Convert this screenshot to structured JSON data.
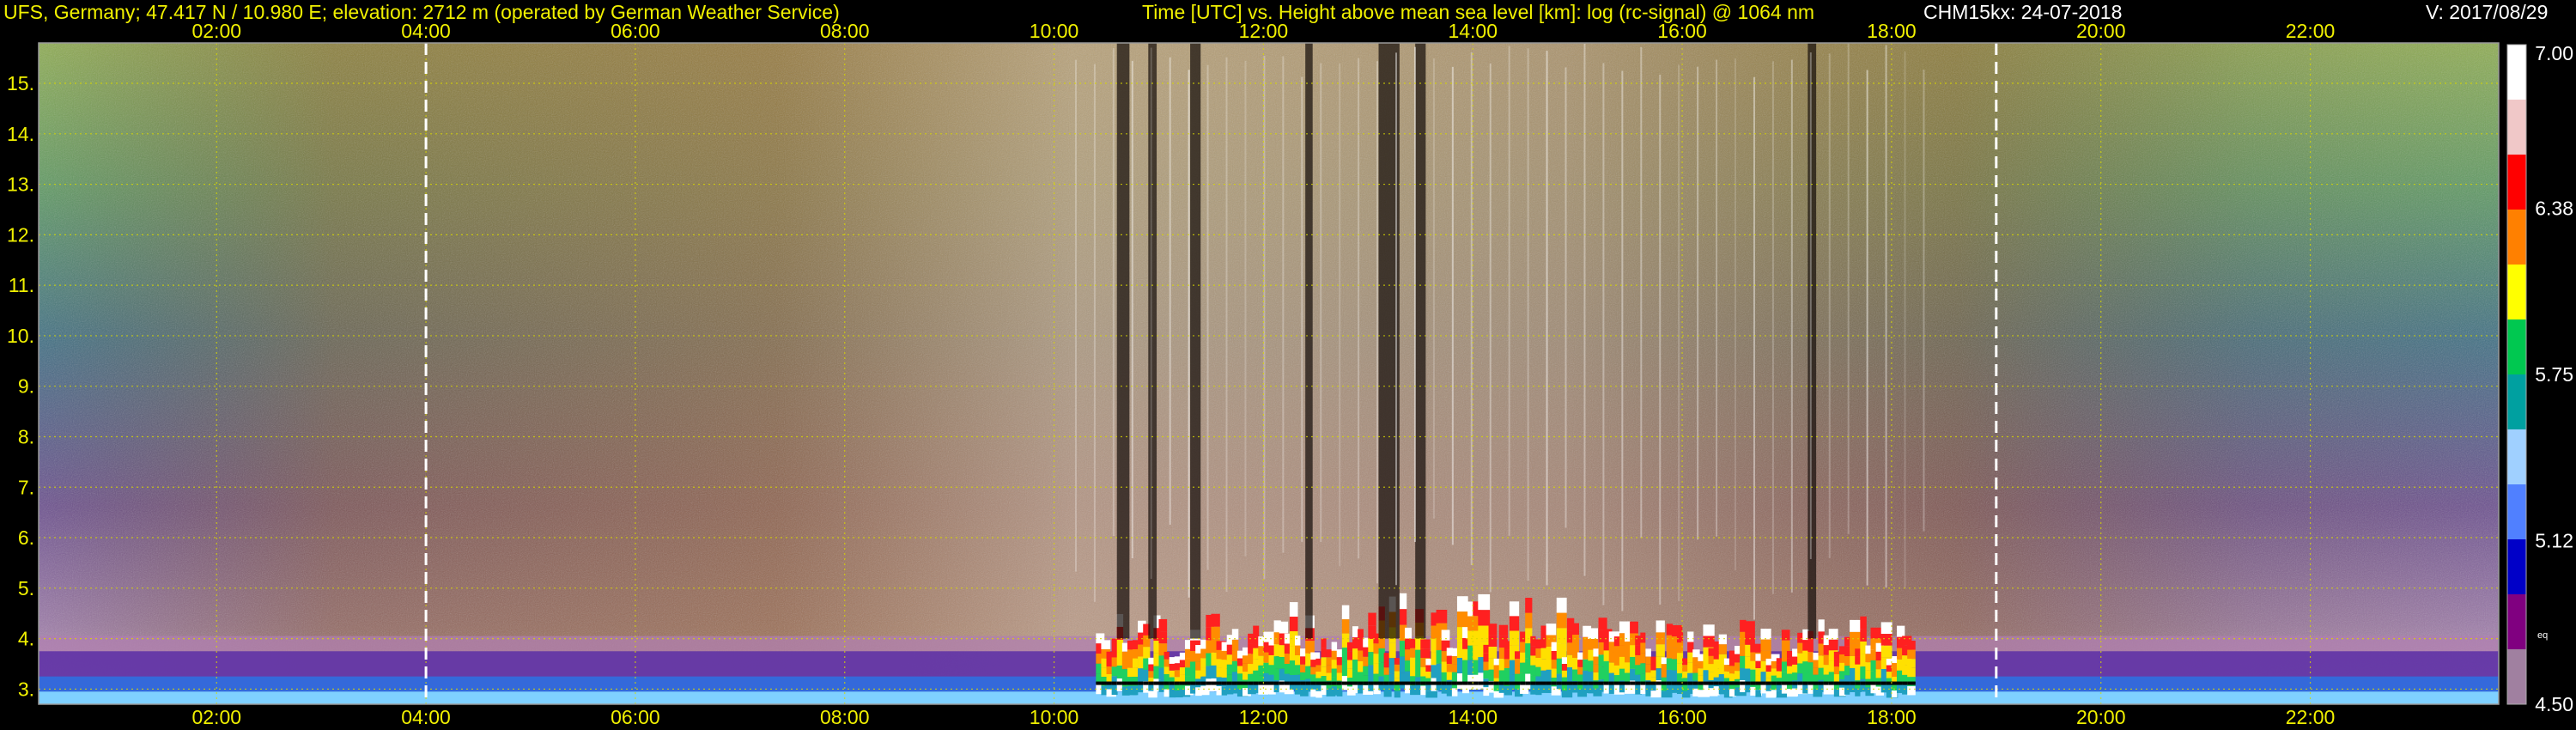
{
  "header": {
    "station": "UFS, Germany; 47.417 N / 10.980 E; elevation: 2712 m  (operated by German Weather Service)",
    "axes_description": "Time [UTC] vs. Height above mean sea level [km]: log (rc-signal) @ 1064 nm",
    "instrument_date": "CHM15kx: 24-07-2018",
    "version": "V: 2017/08/29"
  },
  "colors": {
    "header_text": "#f0f000",
    "tick_text": "#f0f000",
    "gridline": "#d8d800",
    "marker_line": "#ffffff"
  },
  "chart_data": {
    "type": "heatmap",
    "x_axis": {
      "unit": "UTC",
      "range_hours": [
        0.3,
        23.8
      ],
      "ticks": [
        "02:00",
        "04:00",
        "06:00",
        "08:00",
        "10:00",
        "12:00",
        "14:00",
        "16:00",
        "18:00",
        "20:00",
        "22:00"
      ]
    },
    "y_axis": {
      "unit": "km",
      "range": [
        2.7,
        15.8
      ],
      "ticks": [
        "3.",
        "4.",
        "5.",
        "6.",
        "7.",
        "8.",
        "9.",
        "10.",
        "11.",
        "12.",
        "13.",
        "14.",
        "15."
      ]
    },
    "colorbar": {
      "ticks": [
        "7.00",
        "6.38",
        "5.75",
        "5.12",
        "4.50"
      ],
      "range": [
        4.5,
        7.0
      ],
      "extra_label": "eq",
      "colors": [
        "#ffffff",
        "#f0c8c8",
        "#ff0000",
        "#ff8000",
        "#ffff00",
        "#00c850",
        "#00a0a0",
        "#a0d0ff",
        "#5080ff",
        "#0000c8",
        "#800080",
        "#a080a0"
      ]
    },
    "marker_lines_utc": [
      "04:00",
      "19:00"
    ],
    "grid": true
  }
}
